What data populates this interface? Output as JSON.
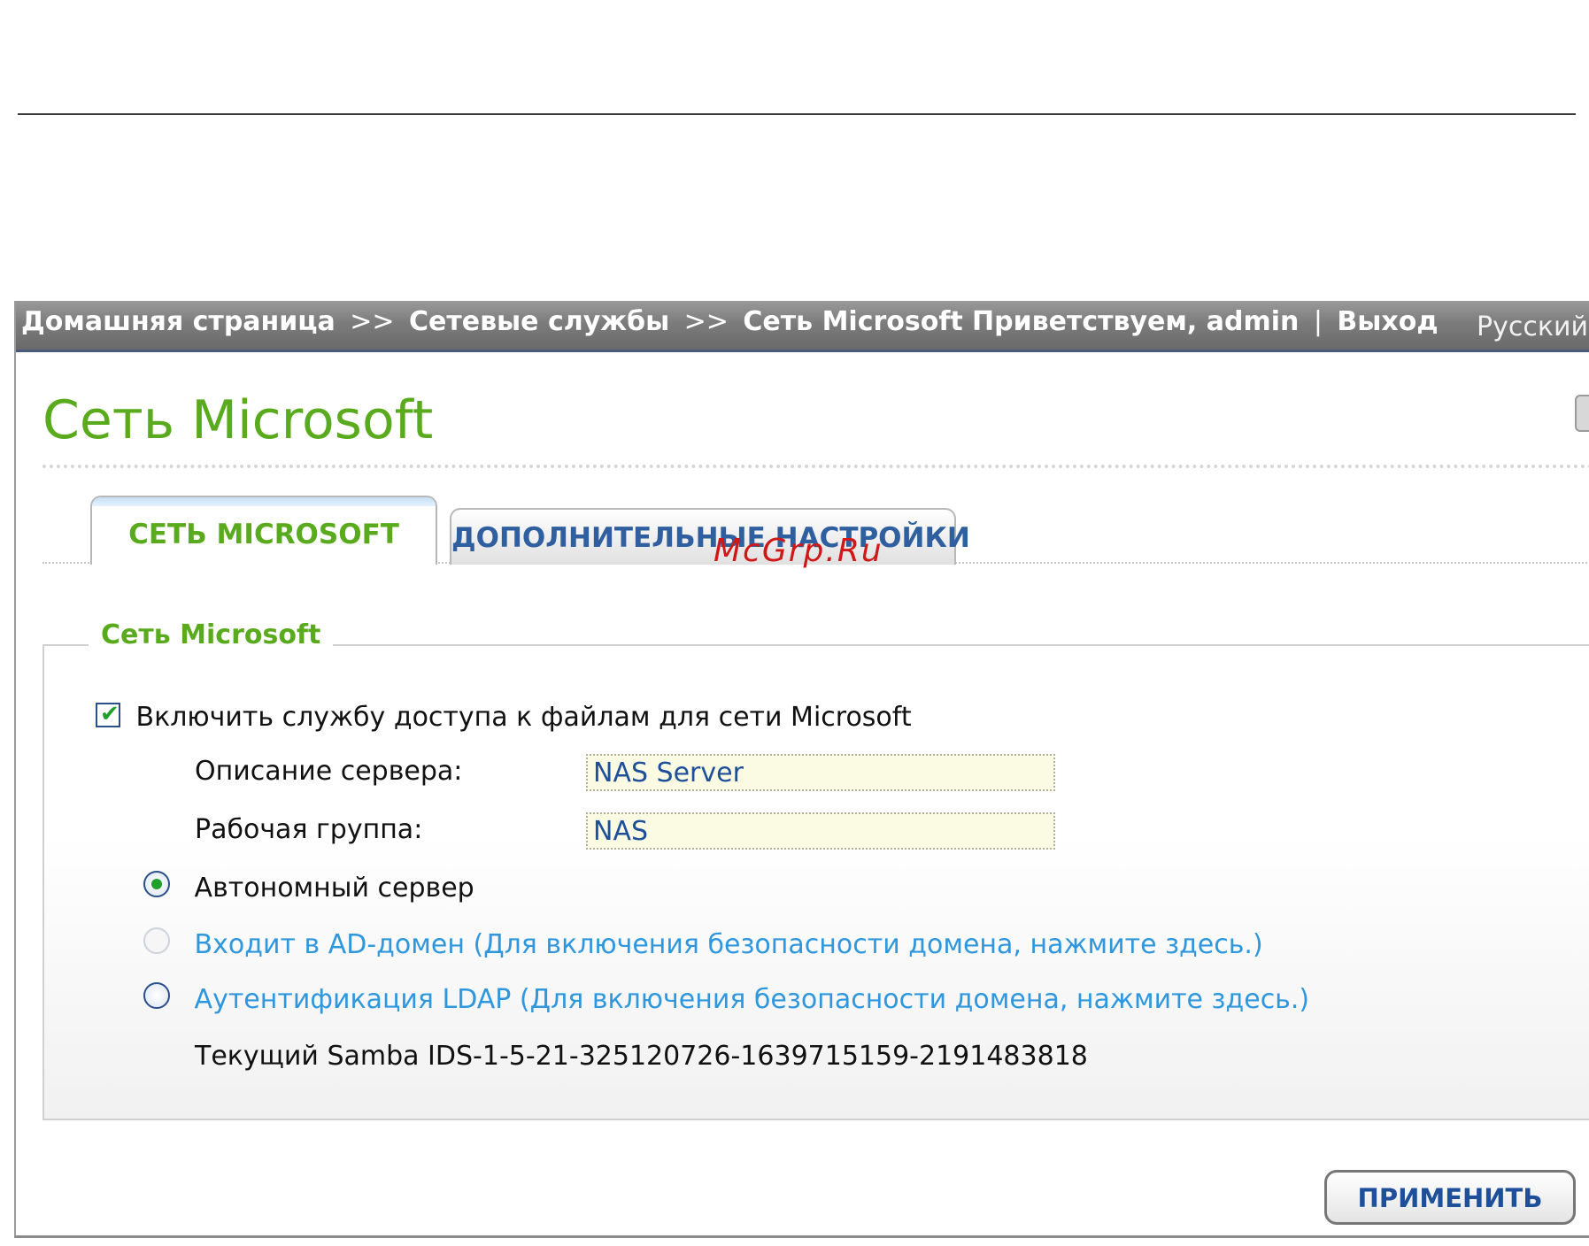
{
  "breadcrumb": {
    "items": [
      "Домашняя страница",
      "Сетевые службы",
      "Сеть Microsoft"
    ],
    "separator": ">>"
  },
  "header": {
    "welcome_label": "Приветствуем,",
    "username": "admin",
    "divider": "|",
    "logout_label": "Выход",
    "language": "Русский"
  },
  "page": {
    "title": "Сеть Microsoft"
  },
  "tabs": [
    {
      "label": "СЕТЬ MICROSOFT",
      "active": true
    },
    {
      "label": "ДОПОЛНИТЕЛЬНЫЕ НАСТРОЙКИ",
      "active": false
    }
  ],
  "watermark": "McGrp.Ru",
  "section": {
    "legend": "Сеть Microsoft",
    "enable_checkbox": {
      "label": "Включить службу доступа к файлам для сети Microsoft",
      "checked": true
    },
    "fields": {
      "server_description": {
        "label": "Описание сервера:",
        "value": "NAS Server"
      },
      "workgroup": {
        "label": "Рабочая группа:",
        "value": "NAS"
      }
    },
    "radios": [
      {
        "label": "Автономный сервер",
        "selected": true,
        "disabled": false
      },
      {
        "label": "Входит в AD-домен (Для включения безопасности домена, нажмите здесь.)",
        "selected": false,
        "disabled": true
      },
      {
        "label": "Аутентификация LDAP (Для включения безопасности домена, нажмите здесь.)",
        "selected": false,
        "disabled": false
      }
    ],
    "samba_id": "Текущий Samba IDS-1-5-21-325120726-1639715159-2191483818"
  },
  "apply_button": "ПРИМЕНИТЬ",
  "colors": {
    "accent_green": "#5aaa1e",
    "link_blue": "#2f97dd",
    "header_gray": "#7c7c7c",
    "watermark_red": "#d01818"
  }
}
